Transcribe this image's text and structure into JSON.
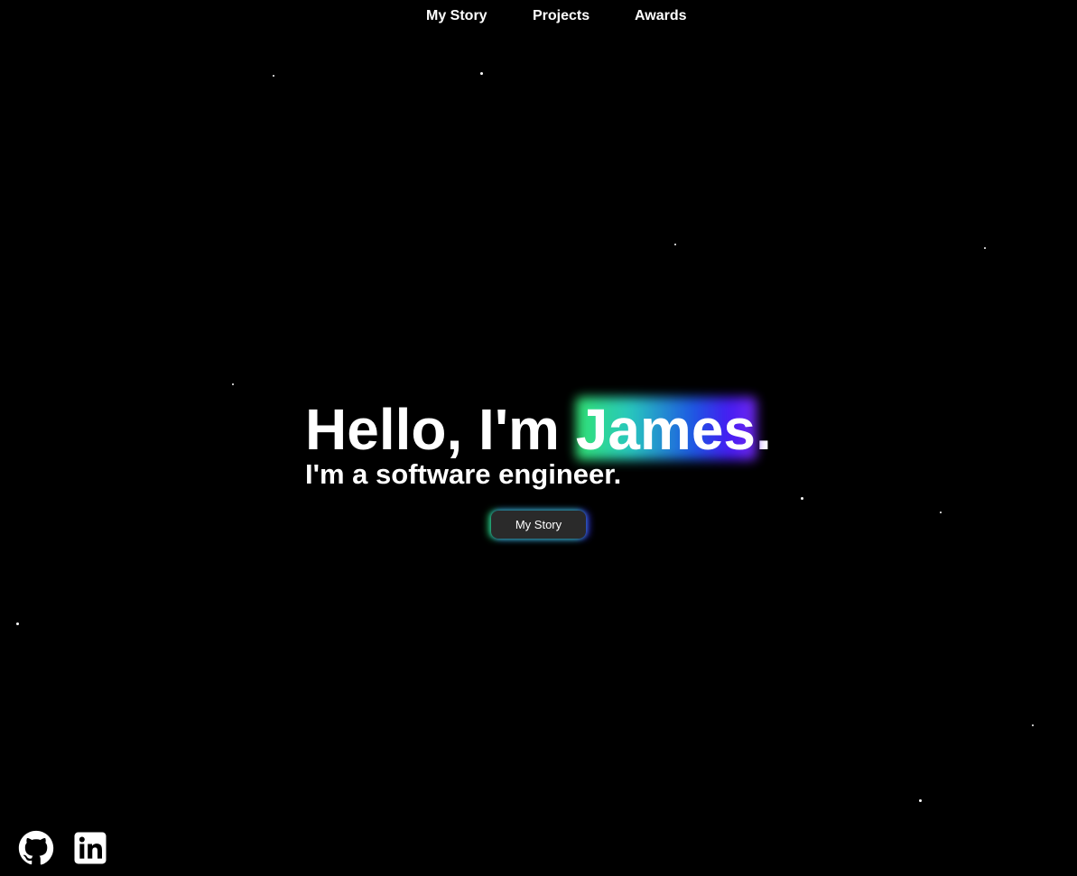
{
  "nav": {
    "items": [
      {
        "label": "My Story"
      },
      {
        "label": "Projects"
      },
      {
        "label": "Awards"
      }
    ]
  },
  "hero": {
    "greeting": "Hello, I'm ",
    "name": "James",
    "punctuation": ".",
    "tagline": "I'm a software engineer.",
    "button_label": "My Story"
  },
  "social": {
    "items": [
      {
        "icon": "github-icon"
      },
      {
        "icon": "linkedin-icon"
      }
    ]
  },
  "colors": {
    "background": "#000000",
    "text": "#ffffff",
    "button_bg": "#2a2a2a",
    "gradient_green": "#35f07a",
    "gradient_blue": "#1f5cf0",
    "gradient_purple": "#7a2cff"
  }
}
